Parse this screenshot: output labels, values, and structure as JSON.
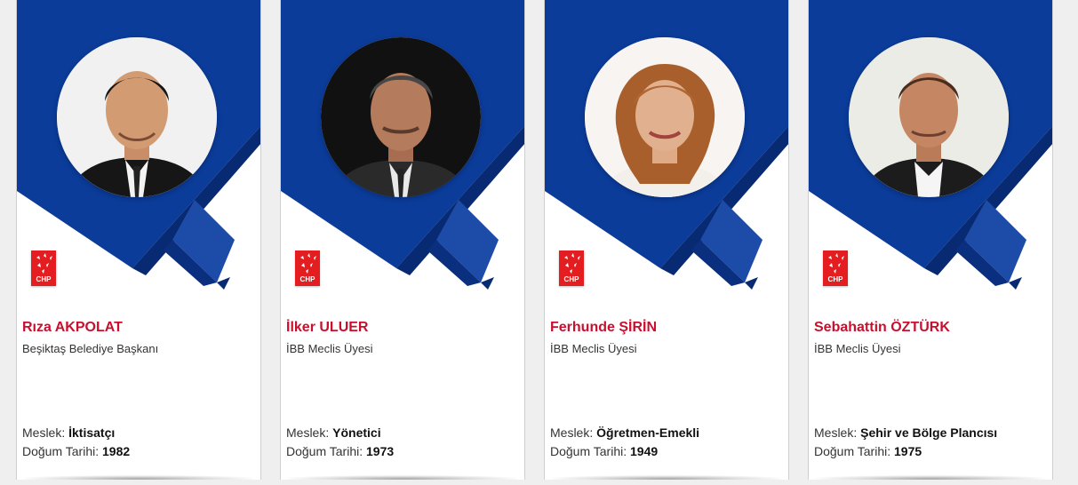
{
  "brand_colors": {
    "blue": "#0b3c9a",
    "blue_dark": "#072a73",
    "red": "#e41e20",
    "name_red": "#c8102e",
    "page_bg": "#efefef"
  },
  "labels": {
    "job": "Meslek:",
    "birth": "Doğum Tarihi:"
  },
  "party_logo_text": "CHP",
  "cards": [
    {
      "name": "Rıza AKPOLAT",
      "role": "Beşiktaş Belediye Başkanı",
      "job": "İktisatçı",
      "birth_year": "1982"
    },
    {
      "name": "İlker ULUER",
      "role": "İBB Meclis Üyesi",
      "job": "Yönetici",
      "birth_year": "1973"
    },
    {
      "name": "Ferhunde ŞİRİN",
      "role": "İBB Meclis Üyesi",
      "job": "Öğretmen-Emekli",
      "birth_year": "1949"
    },
    {
      "name": "Sebahattin ÖZTÜRK",
      "role": "İBB Meclis Üyesi",
      "job": "Şehir ve Bölge Plancısı",
      "birth_year": "1975"
    }
  ]
}
